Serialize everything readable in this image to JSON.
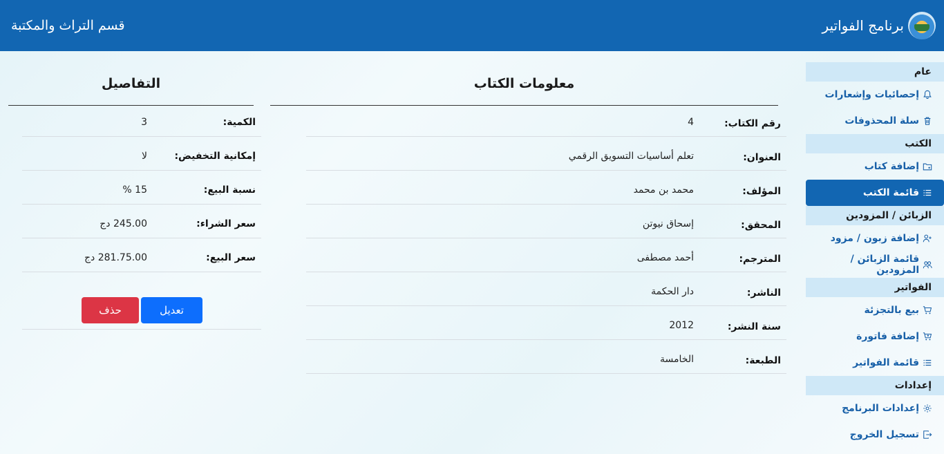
{
  "header": {
    "brand_title": "برنامج الفواتير",
    "department": "قسم التراث والمكتبة"
  },
  "sidebar": {
    "sections": [
      {
        "title": "عام"
      },
      {
        "title": "الكتب"
      },
      {
        "title": "الزبائن / المزودين"
      },
      {
        "title": "الفواتير"
      },
      {
        "title": "إعدادات"
      }
    ],
    "items": [
      {
        "label": "إحصائيات وإشعارات",
        "icon": "bell-icon"
      },
      {
        "label": "سلة المحذوفات",
        "icon": "trash-icon"
      },
      {
        "label": "إضافة كتاب",
        "icon": "folder-plus-icon"
      },
      {
        "label": "قائمة الكتب",
        "icon": "list-icon"
      },
      {
        "label": "إضافة زبون / مزود",
        "icon": "person-add-icon"
      },
      {
        "label": "قائمة الزبائن / المزودين",
        "icon": "people-icon"
      },
      {
        "label": "بيع بالتجزئة",
        "icon": "cart-icon"
      },
      {
        "label": "إضافة فاتورة",
        "icon": "cart-plus-icon"
      },
      {
        "label": "قائمة الفواتير",
        "icon": "list-icon"
      },
      {
        "label": "إعدادات البرنامج",
        "icon": "gear-icon"
      },
      {
        "label": "تسجيل الخروج",
        "icon": "logout-icon"
      }
    ],
    "active_item": "قائمة الكتب"
  },
  "book_info": {
    "title": "معلومات الكتاب",
    "rows": [
      {
        "label": "رقم الكتاب:",
        "value": "4"
      },
      {
        "label": "العنوان:",
        "value": "تعلم أساسيات التسويق الرقمي"
      },
      {
        "label": "المؤلف:",
        "value": "محمد بن محمد"
      },
      {
        "label": "المحقق:",
        "value": "إسحاق نيوتن"
      },
      {
        "label": "المترجم:",
        "value": "أحمد مصطفى"
      },
      {
        "label": "الناشر:",
        "value": "دار الحكمة"
      },
      {
        "label": "سنة النشر:",
        "value": "2012"
      },
      {
        "label": "الطبعة:",
        "value": "الخامسة"
      }
    ]
  },
  "details": {
    "title": "التفاصيل",
    "rows": [
      {
        "label": "الكمية:",
        "value": "3"
      },
      {
        "label": "إمكانية التخفيض:",
        "value": "لا"
      },
      {
        "label": "نسبة البيع:",
        "value": "15 %"
      },
      {
        "label": "سعر الشراء:",
        "value": "245.00 دج"
      },
      {
        "label": "سعر البيع:",
        "value": "281.75.00 دج"
      }
    ],
    "edit_label": "تعديل",
    "delete_label": "حذف"
  }
}
